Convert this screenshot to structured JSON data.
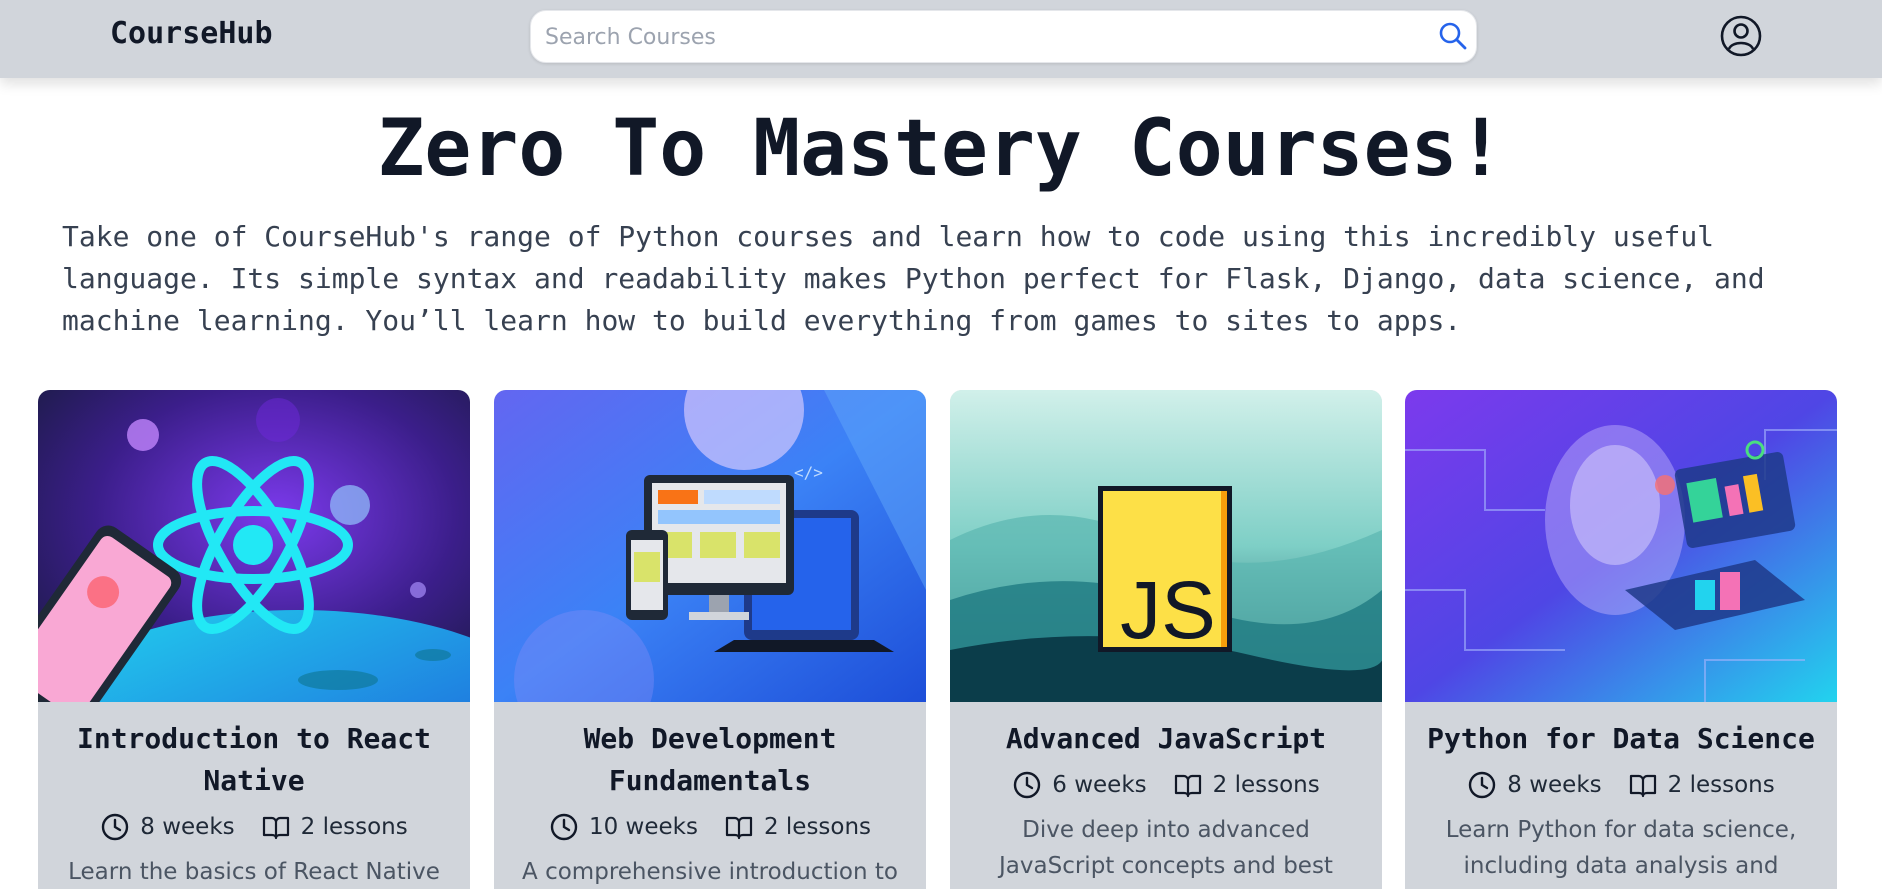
{
  "header": {
    "brand": "CourseHub",
    "search_placeholder": "Search Courses",
    "search_icon": "search-icon",
    "profile_icon": "user-circle-icon"
  },
  "hero": {
    "title": "Zero To Mastery Courses!",
    "description": "Take one of CourseHub's range of Python courses and learn how to code using this incredibly useful language. Its simple syntax and readability makes Python perfect for Flask, Django, data science, and machine learning. You’ll learn how to build everything from games to sites to apps."
  },
  "courses": [
    {
      "title": "Introduction to React Native",
      "duration": "8 weeks",
      "lessons": "2 lessons",
      "description": "Learn the basics of React Native"
    },
    {
      "title": "Web Development Fundamentals",
      "duration": "10 weeks",
      "lessons": "2 lessons",
      "description": "A comprehensive introduction to web"
    },
    {
      "title": "Advanced JavaScript",
      "duration": "6 weeks",
      "lessons": "2 lessons",
      "description": "Dive deep into advanced JavaScript concepts and best practices."
    },
    {
      "title": "Python for Data Science",
      "duration": "8 weeks",
      "lessons": "2 lessons",
      "description": "Learn Python for data science, including data analysis and"
    }
  ],
  "colors": {
    "navbar": "#d1d5db",
    "card_body": "#d1d5db",
    "accent_blue": "#2563eb",
    "text_dark": "#111827"
  }
}
